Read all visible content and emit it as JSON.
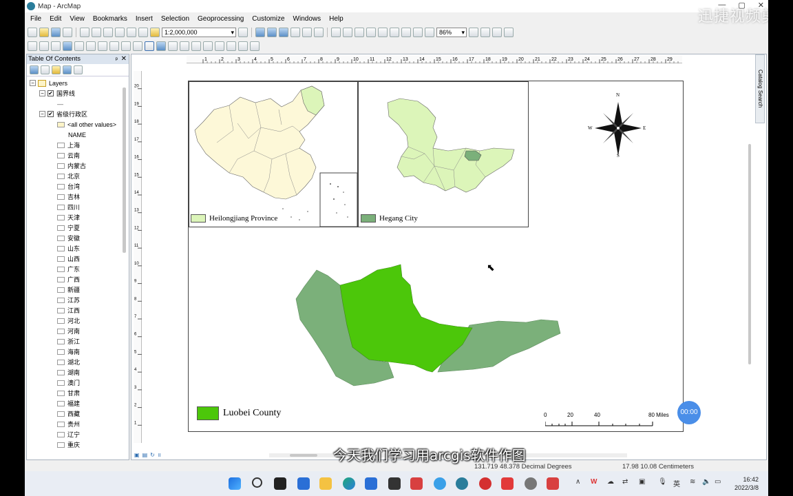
{
  "window": {
    "title": "Map - ArcMap",
    "controls": [
      "—",
      "▢",
      "✕"
    ]
  },
  "watermark": "迅捷视频剪辑",
  "menu": [
    "File",
    "Edit",
    "View",
    "Bookmarks",
    "Insert",
    "Selection",
    "Geoprocessing",
    "Customize",
    "Windows",
    "Help"
  ],
  "toolbar": {
    "scale": "1:2,000,000",
    "zoom_percent": "86%"
  },
  "toc": {
    "title": "Table Of Contents",
    "layers_label": "Layers",
    "layer1": "国界线",
    "layer1_line": "—",
    "layer2": "省级行政区",
    "all_other": "<all other values>",
    "field": "NAME",
    "provinces": [
      "上海",
      "云南",
      "内蒙古",
      "北京",
      "台湾",
      "吉林",
      "四川",
      "天津",
      "宁夏",
      "安徽",
      "山东",
      "山西",
      "广东",
      "广西",
      "新疆",
      "江苏",
      "江西",
      "河北",
      "河南",
      "浙江",
      "海南",
      "湖北",
      "湖南",
      "澳门",
      "甘肃",
      "福建",
      "西藏",
      "贵州",
      "辽宁",
      "重庆"
    ]
  },
  "ruler": {
    "h_ticks": [
      "1",
      "2",
      "3",
      "4",
      "5",
      "6",
      "7",
      "8",
      "9",
      "10",
      "11",
      "12",
      "13",
      "14",
      "15",
      "16",
      "17",
      "18",
      "19",
      "20",
      "21",
      "22",
      "23",
      "24",
      "25",
      "26",
      "27",
      "28",
      "29"
    ],
    "v_ticks": [
      "20",
      "19",
      "18",
      "17",
      "16",
      "15",
      "14",
      "13",
      "12",
      "11",
      "10",
      "9",
      "8",
      "7",
      "6",
      "5",
      "4",
      "3",
      "2",
      "1"
    ]
  },
  "side_dock": {
    "catalog": "Catalog",
    "search": "Search"
  },
  "map": {
    "legend_china": "Heilongjiang Province",
    "legend_hlj": "Hegang City",
    "legend_main": "Luobei County",
    "north": {
      "n": "N",
      "s": "S",
      "e": "E",
      "w": "W"
    },
    "scalebar": {
      "ticks": [
        "0",
        "20",
        "40",
        "80 Miles"
      ]
    },
    "colors": {
      "light_yellow": "#fdf8d8",
      "light_green": "#dcf5b9",
      "dark_green": "#7bb07a",
      "bright_green": "#4cc70a"
    }
  },
  "timer": "00:00",
  "subtitle": "今天我们学习用arcgis软件作图",
  "status": {
    "coords": "131.719  48.378 Decimal Degrees",
    "page_pos": "17.98  10.08 Centimeters"
  },
  "taskbar": {
    "lang": "英",
    "time": "16:42",
    "date": "2022/3/8"
  }
}
